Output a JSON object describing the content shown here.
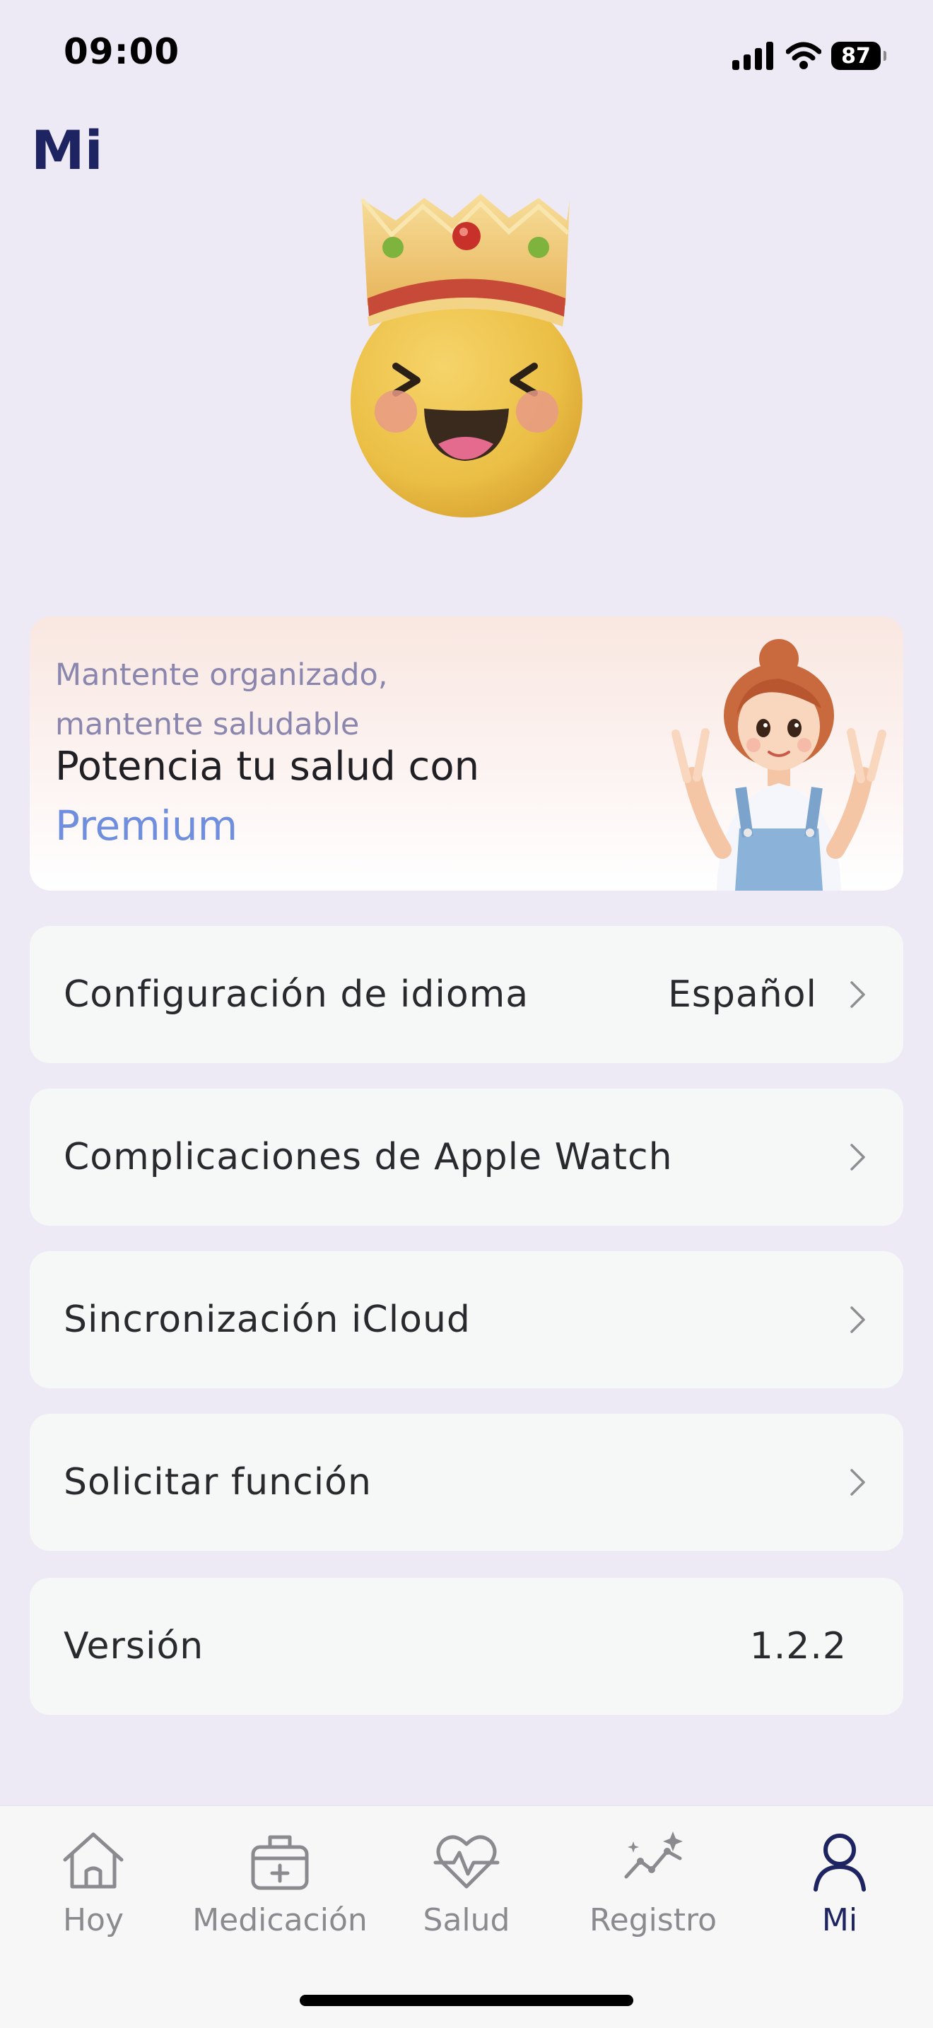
{
  "status_bar": {
    "time": "09:00",
    "battery": "87",
    "icons": [
      "signal-icon",
      "wifi-icon",
      "battery-icon"
    ]
  },
  "header": {
    "title": "Mi"
  },
  "premium": {
    "subtitle_line1": "Mantente organizado,",
    "subtitle_line2": "mantente saludable",
    "headline": "Potencia tu salud con",
    "accent": "Premium"
  },
  "settings": {
    "language": {
      "label": "Configuración de idioma",
      "value": "Español"
    },
    "apple_watch": {
      "label": "Complicaciones de Apple Watch"
    },
    "icloud": {
      "label": "Sincronización iCloud"
    },
    "feature_request": {
      "label": "Solicitar función"
    },
    "version": {
      "label": "Versión",
      "value": "1.2.2"
    }
  },
  "tabbar": {
    "tabs": [
      {
        "label": "Hoy",
        "icon": "home-icon"
      },
      {
        "label": "Medicación",
        "icon": "medical-kit-icon"
      },
      {
        "label": "Salud",
        "icon": "heart-pulse-icon"
      },
      {
        "label": "Registro",
        "icon": "trend-sparkle-icon"
      },
      {
        "label": "Mi",
        "icon": "person-icon"
      }
    ],
    "active": "Mi"
  },
  "colors": {
    "background": "#EDEAF5",
    "title": "#1E2461",
    "accent": "#6F8EDD",
    "row_background": "#F6F7F7",
    "tab_inactive": "#8A8A8F"
  }
}
